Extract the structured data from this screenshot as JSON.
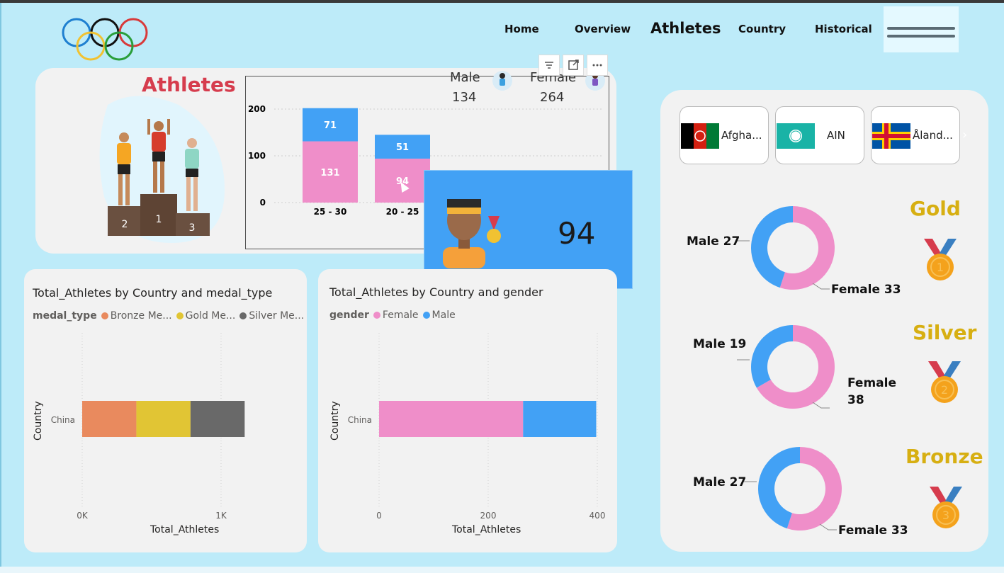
{
  "nav": {
    "home": "Home",
    "overview": "Overview",
    "athletes": "Athletes",
    "country": "Country",
    "historical": "Historical"
  },
  "header_card": {
    "title": "Athletes",
    "podium_numbers": [
      "2",
      "1",
      "3"
    ]
  },
  "gender_summary": {
    "male_label": "Male",
    "male_value": "134",
    "female_label": "Female",
    "female_value": "264"
  },
  "age_chart": {
    "chart_data": {
      "type": "bar",
      "categories": [
        "25 - 30",
        "20 - 25"
      ],
      "series": [
        {
          "name": "Female",
          "values": [
            131,
            94
          ]
        },
        {
          "name": "Male",
          "values": [
            71,
            51
          ]
        }
      ],
      "y_ticks": [
        "200",
        "100",
        "0"
      ],
      "ylim": [
        0,
        200
      ]
    }
  },
  "tooltip": {
    "value": "94"
  },
  "medal_chart": {
    "title": "Total_Athletes by Country and medal_type",
    "legend_title": "medal_type",
    "legend": [
      "Bronze Me...",
      "Gold Me...",
      "Silver Me..."
    ],
    "ylabel": "Country",
    "xlabel": "Total_Athletes",
    "x_ticks": [
      "0K",
      "1K"
    ],
    "category": "China",
    "colors": [
      "#e98a5e",
      "#e1c534",
      "#696969"
    ],
    "chart_data": {
      "type": "bar",
      "categories": [
        "China"
      ],
      "series": [
        {
          "name": "Bronze Me...",
          "values": [
            390
          ]
        },
        {
          "name": "Gold Me...",
          "values": [
            390
          ]
        },
        {
          "name": "Silver Me...",
          "values": [
            390
          ]
        }
      ],
      "xlim": [
        0,
        1000
      ]
    }
  },
  "gender_chart": {
    "title": "Total_Athletes by Country and gender",
    "legend_title": "gender",
    "legend": [
      "Female",
      "Male"
    ],
    "ylabel": "Country",
    "xlabel": "Total_Athletes",
    "x_ticks": [
      "0",
      "200",
      "400"
    ],
    "category": "China",
    "colors": [
      "#ef8ec9",
      "#42a1f5"
    ],
    "chart_data": {
      "type": "bar",
      "categories": [
        "China"
      ],
      "series": [
        {
          "name": "Female",
          "values": [
            264
          ]
        },
        {
          "name": "Male",
          "values": [
            134
          ]
        }
      ],
      "xlim": [
        0,
        400
      ]
    }
  },
  "countries": [
    {
      "name": "Afgha..."
    },
    {
      "name": "AIN"
    },
    {
      "name": "Åland..."
    }
  ],
  "medals": [
    {
      "title": "Gold",
      "male": "Male 27",
      "female": "Female 33",
      "badge": "1",
      "chart_data": {
        "type": "pie",
        "labels": [
          "Male",
          "Female"
        ],
        "values": [
          27,
          33
        ]
      }
    },
    {
      "title": "Silver",
      "male": "Male 19",
      "female_line1": "Female",
      "female_line2": "38",
      "badge": "2",
      "chart_data": {
        "type": "pie",
        "labels": [
          "Male",
          "Female"
        ],
        "values": [
          19,
          38
        ]
      }
    },
    {
      "title": "Bronze",
      "male": "Male 27",
      "female": "Female 33",
      "badge": "3",
      "chart_data": {
        "type": "pie",
        "labels": [
          "Male",
          "Female"
        ],
        "values": [
          27,
          33
        ]
      }
    }
  ],
  "colors": {
    "female": "#ef8ec9",
    "male": "#42a1f5",
    "title_red": "#d63c4d",
    "medal_gold": "#d7af12"
  }
}
